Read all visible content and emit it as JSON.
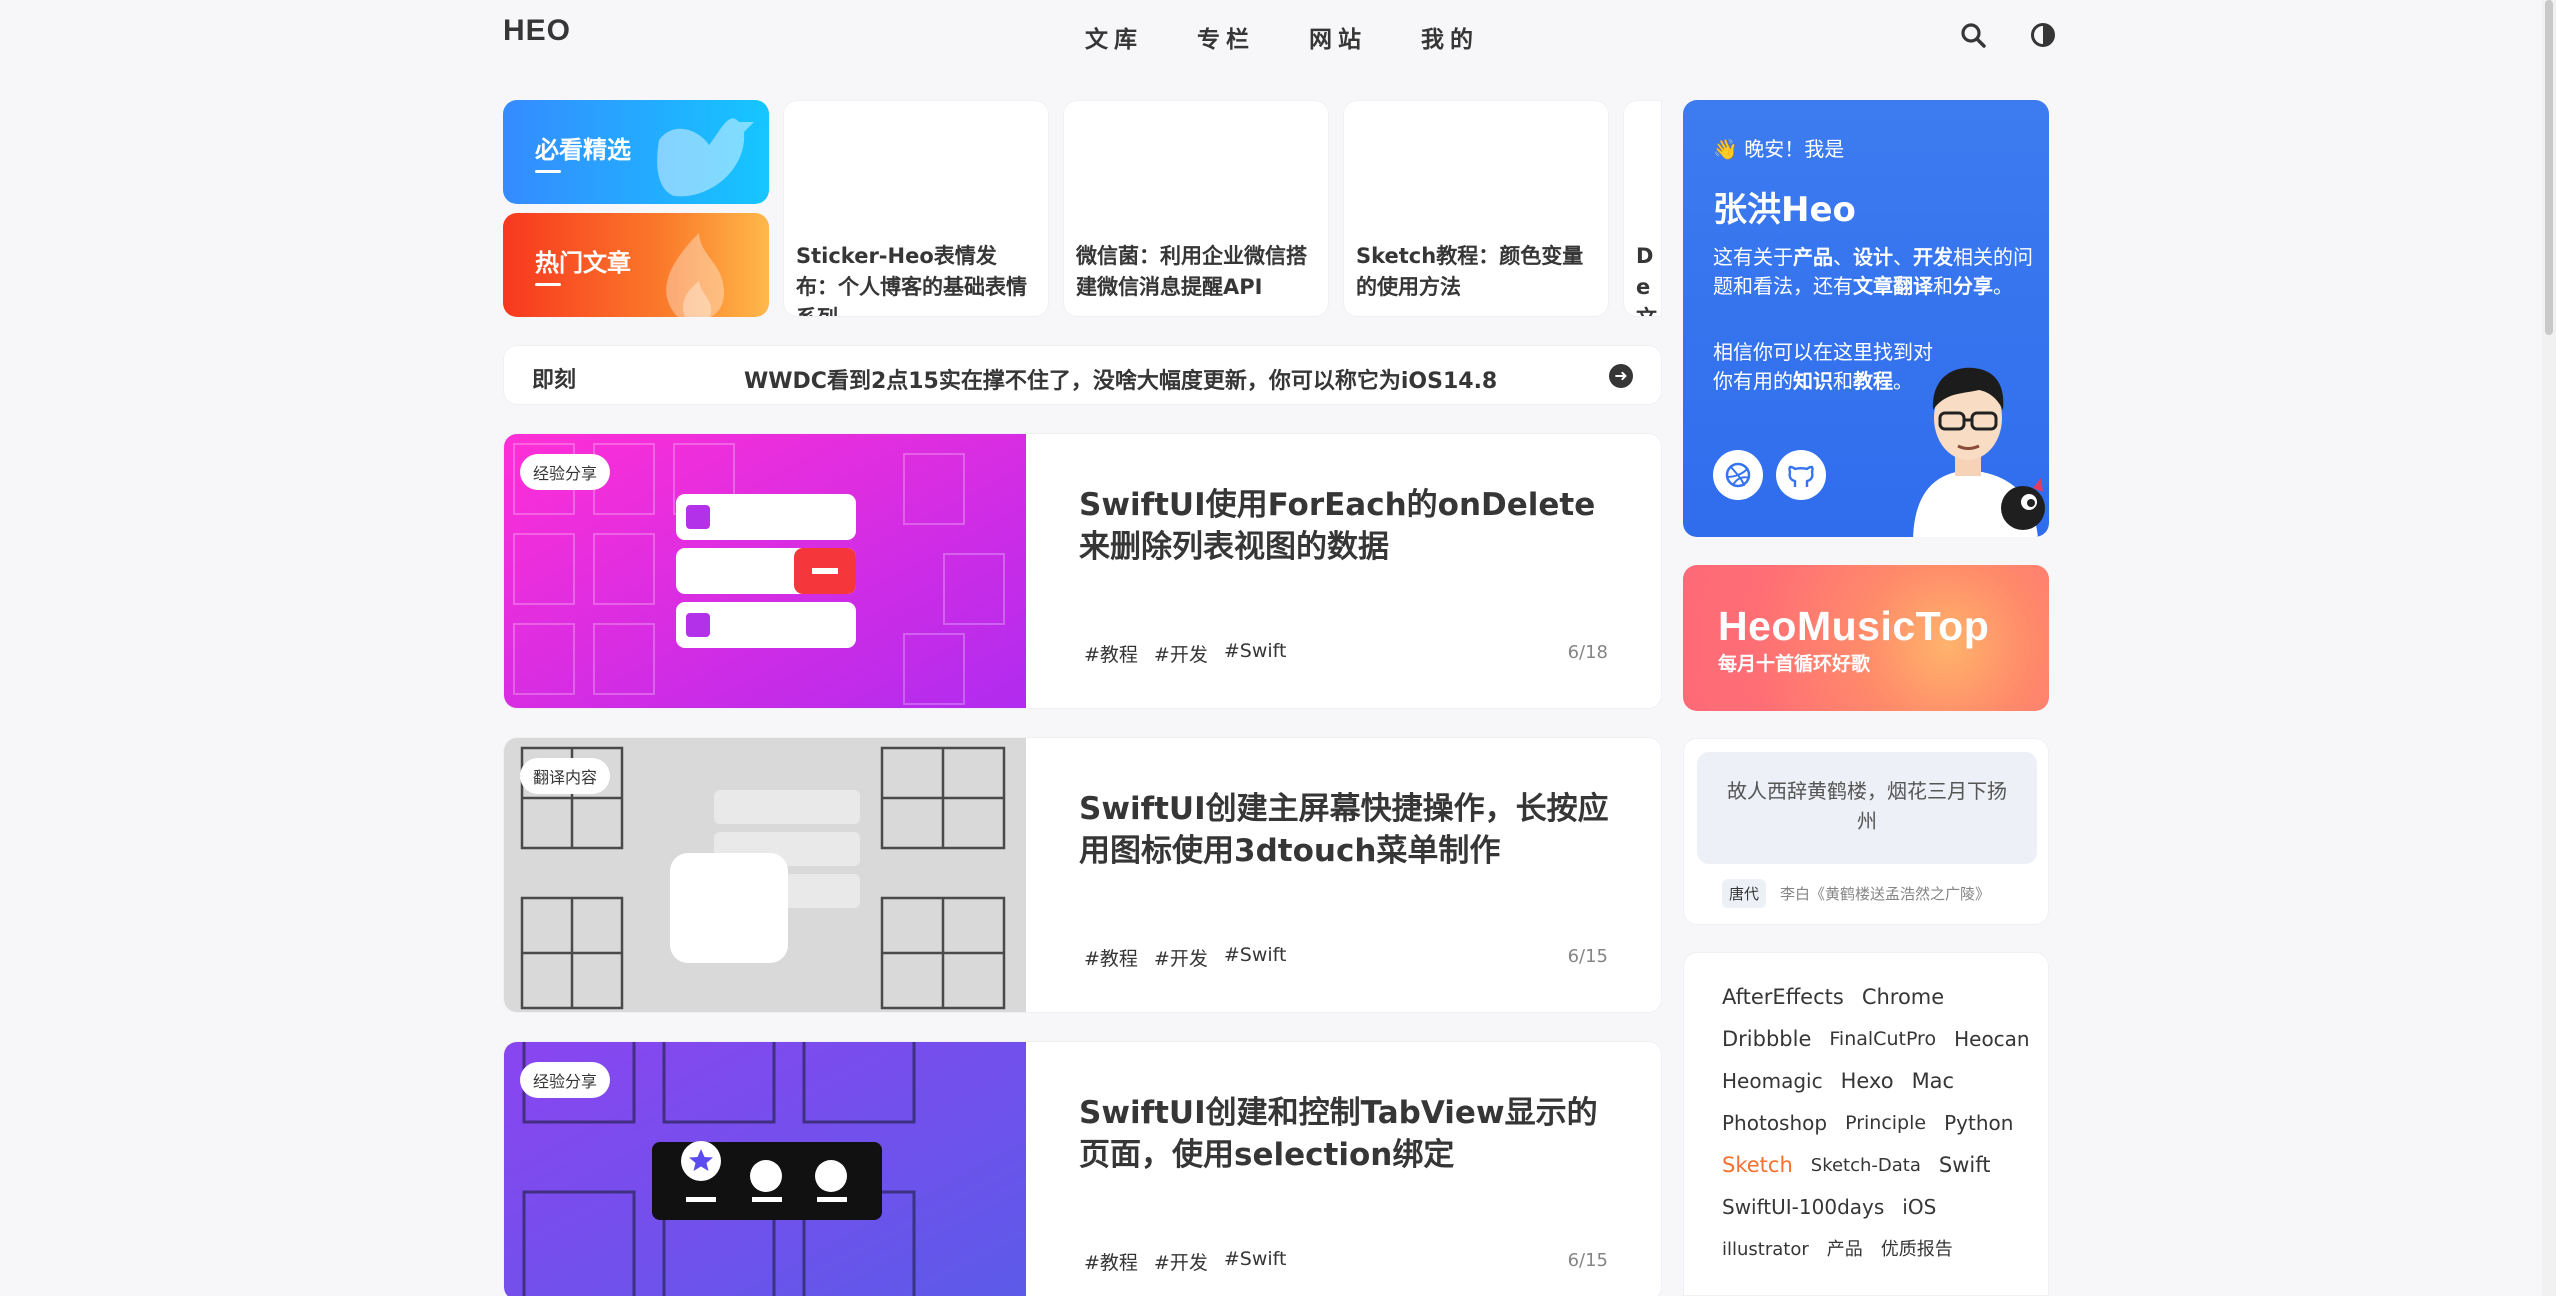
{
  "nav": {
    "logo": "HEO",
    "menu": [
      "文库",
      "专栏",
      "网站",
      "我的"
    ]
  },
  "categories": [
    {
      "label": "必看精选"
    },
    {
      "label": "热门文章"
    }
  ],
  "top_posts": [
    {
      "title": "Sticker-Heo表情发布：个人博客的基础表情系列"
    },
    {
      "title": "微信菌：利用企业微信搭建微信消息提醒API"
    },
    {
      "title": "Sketch教程：颜色变量的使用方法"
    },
    {
      "title": "De文"
    }
  ],
  "ticker": {
    "keyword": "即刻",
    "message": "WWDC看到2点15实在撑不住了，没啥大幅度更新，你可以称它为iOS14.8"
  },
  "posts": [
    {
      "category": "经验分享",
      "title": "SwiftUI使用ForEach的onDelete来删除列表视图的数据",
      "tags": [
        "#教程",
        "#开发",
        "#Swift"
      ],
      "date": "6/18"
    },
    {
      "category": "翻译内容",
      "title": "SwiftUI创建主屏幕快捷操作，长按应用图标使用3dtouch菜单制作",
      "tags": [
        "#教程",
        "#开发",
        "#Swift"
      ],
      "date": "6/15"
    },
    {
      "category": "经验分享",
      "title": "SwiftUI创建和控制TabView显示的页面，使用selection绑定",
      "tags": [
        "#教程",
        "#开发",
        "#Swift"
      ],
      "date": "6/15"
    }
  ],
  "author": {
    "greeting": "👋 晚安！我是",
    "name": "张洪Heo",
    "desc_parts": [
      "这有关于",
      "产品",
      "、",
      "设计",
      "、",
      "开发",
      "相关的问题和看法，还有",
      "文章翻译",
      "和",
      "分享",
      "。"
    ],
    "desc2_parts": [
      "相信你可以在这里找到对你有用的",
      "知识",
      "和",
      "教程",
      "。"
    ]
  },
  "music": {
    "title": "HeoMusicTop",
    "subtitle": "每月十首循环好歌"
  },
  "poem": {
    "text": "故人西辞黄鹤楼，烟花三月下扬州",
    "era": "唐代",
    "source": "李白《黄鹤楼送孟浩然之广陵》"
  },
  "tagcloud": [
    {
      "name": "AfterEffects",
      "size": 21
    },
    {
      "name": "Chrome",
      "size": 21
    },
    {
      "name": "Dribbble",
      "size": 21
    },
    {
      "name": "FinalCutPro",
      "size": 19
    },
    {
      "name": "Heocan",
      "size": 20
    },
    {
      "name": "Heomagic",
      "size": 20
    },
    {
      "name": "Hexo",
      "size": 21
    },
    {
      "name": "Mac",
      "size": 21
    },
    {
      "name": "Photoshop",
      "size": 20
    },
    {
      "name": "Principle",
      "size": 19
    },
    {
      "name": "Python",
      "size": 20
    },
    {
      "name": "Sketch",
      "size": 21,
      "highlight": true
    },
    {
      "name": "Sketch-Data",
      "size": 18
    },
    {
      "name": "Swift",
      "size": 21
    },
    {
      "name": "SwiftUI-100days",
      "size": 20
    },
    {
      "name": "iOS",
      "size": 20
    },
    {
      "name": "illustrator",
      "size": 18
    },
    {
      "name": "产品",
      "size": 18
    },
    {
      "name": "优质报告",
      "size": 18
    }
  ]
}
